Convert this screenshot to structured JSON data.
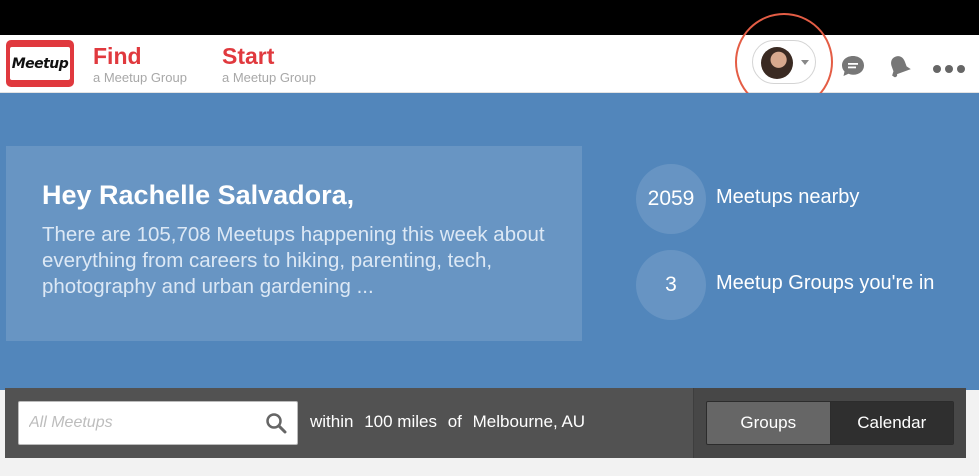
{
  "header": {
    "logo_text": "Meetup",
    "find": {
      "label": "Find",
      "sub": "a Meetup Group"
    },
    "start": {
      "label": "Start",
      "sub": "a Meetup Group"
    }
  },
  "icons": {
    "chat": "chat-bubble-icon",
    "notifications": "bell-icon",
    "more": "more-dots-icon",
    "search": "search-icon"
  },
  "hero": {
    "title": "Hey Rachelle Salvadora,",
    "text": "There are 105,708 Meetups happening this week about everything from careers to hiking, parenting, tech, photography and urban gardening ...",
    "stats": [
      {
        "value": "2059",
        "label": "Meetups nearby"
      },
      {
        "value": "3",
        "label": "Meetup Groups you're in"
      }
    ]
  },
  "search": {
    "placeholder": "All Meetups",
    "within": "within",
    "distance": "100 miles",
    "of": "of",
    "location": "Melbourne, AU"
  },
  "view_toggle": {
    "groups": "Groups",
    "calendar": "Calendar",
    "selected": "Calendar"
  },
  "colors": {
    "brand_red": "#e0393e",
    "hero_blue": "#5286bb",
    "highlight_ring": "#e45d45"
  }
}
